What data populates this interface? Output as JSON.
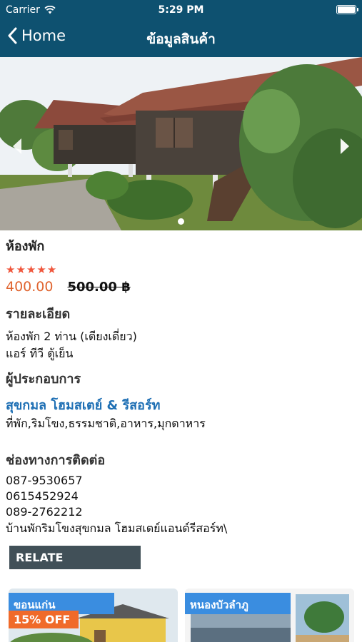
{
  "status_bar": {
    "carrier": "Carrier",
    "time": "5:29 PM"
  },
  "nav": {
    "back_label": "Home",
    "title": "ข้อมูลสินค้า"
  },
  "carousel": {
    "slides": 1,
    "active_index": 0
  },
  "product": {
    "category": "ห้องพัก",
    "rating": 5,
    "stars": "★★★★★",
    "price": "400.00",
    "original_price": "500.00 ฿"
  },
  "details": {
    "heading": "รายละเอียด",
    "line1": "ห้องพัก 2 ท่าน (เตียงเดี่ยว)",
    "line2": "แอร์ ทีวี ตู้เย็น"
  },
  "operator": {
    "heading": "ผู้ประกอบการ",
    "name": "สุขกมล โฮมสเตย์ & รีสอร์ท",
    "tags": "ที่พัก,ริมโขง,ธรรมชาติ,อาหาร,มุกดาหาร"
  },
  "contact": {
    "heading": "ช่องทางการติดต่อ",
    "phone1": "087-9530657",
    "phone2": "0615452924",
    "phone3": "089-2762212",
    "address": "บ้านพักริมโขงสุขกมล โฮมสเตย์แอนด์รีสอร์ท\\"
  },
  "related": {
    "heading": "RELATE",
    "items": [
      {
        "location": "ขอนแก่น",
        "discount": "15% OFF"
      },
      {
        "location": "หนองบัวลำภู"
      }
    ]
  },
  "colors": {
    "nav_bg": "#0e5170",
    "price": "#e0642f",
    "stars": "#f0563c",
    "link": "#1e6fb4",
    "relate_bar": "#415058",
    "card_label": "#3a8de0",
    "discount_badge": "#f06a2a"
  },
  "icons": {
    "back": "chevron-left-icon",
    "wifi": "wifi-icon",
    "battery": "battery-icon",
    "carousel_prev": "chevron-left-icon",
    "carousel_next": "chevron-right-icon"
  }
}
